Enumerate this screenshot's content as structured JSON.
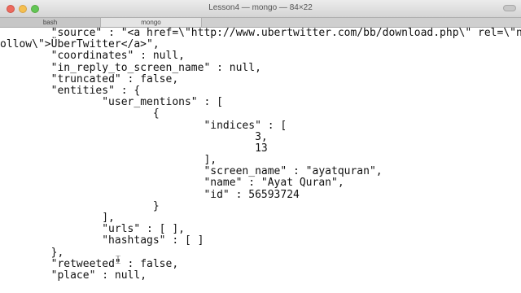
{
  "window": {
    "title": "Lesson4 — mongo — 84×22",
    "tabs": [
      {
        "label": "bash",
        "active": false
      },
      {
        "label": "mongo",
        "active": true
      }
    ]
  },
  "terminal": {
    "lines": [
      "\t\"source\" : \"<a href=\\\"http://www.ubertwitter.com/bb/download.php\\\" rel=\\\"nof",
      "ollow\\\">ÜberTwitter</a>\",",
      "\t\"coordinates\" : null,",
      "\t\"in_reply_to_screen_name\" : null,",
      "\t\"truncated\" : false,",
      "\t\"entities\" : {",
      "\t\t\"user_mentions\" : [",
      "\t\t\t{",
      "\t\t\t\t\"indices\" : [",
      "\t\t\t\t\t3,",
      "\t\t\t\t\t13",
      "\t\t\t\t],",
      "\t\t\t\t\"screen_name\" : \"ayatquran\",",
      "\t\t\t\t\"name\" : \"Ayat Quran\",",
      "\t\t\t\t\"id\" : 56593724",
      "\t\t\t}",
      "\t\t],",
      "\t\t\"urls\" : [ ],",
      "\t\t\"hashtags\" : [ ]",
      "\t},",
      "\t\"retweeted\" : false,",
      "\t\"place\" : null,"
    ]
  },
  "colors": {
    "text": "#111111",
    "background": "#ffffff"
  },
  "icons": {
    "mouse_cursor": "ibeam-cursor-icon"
  }
}
